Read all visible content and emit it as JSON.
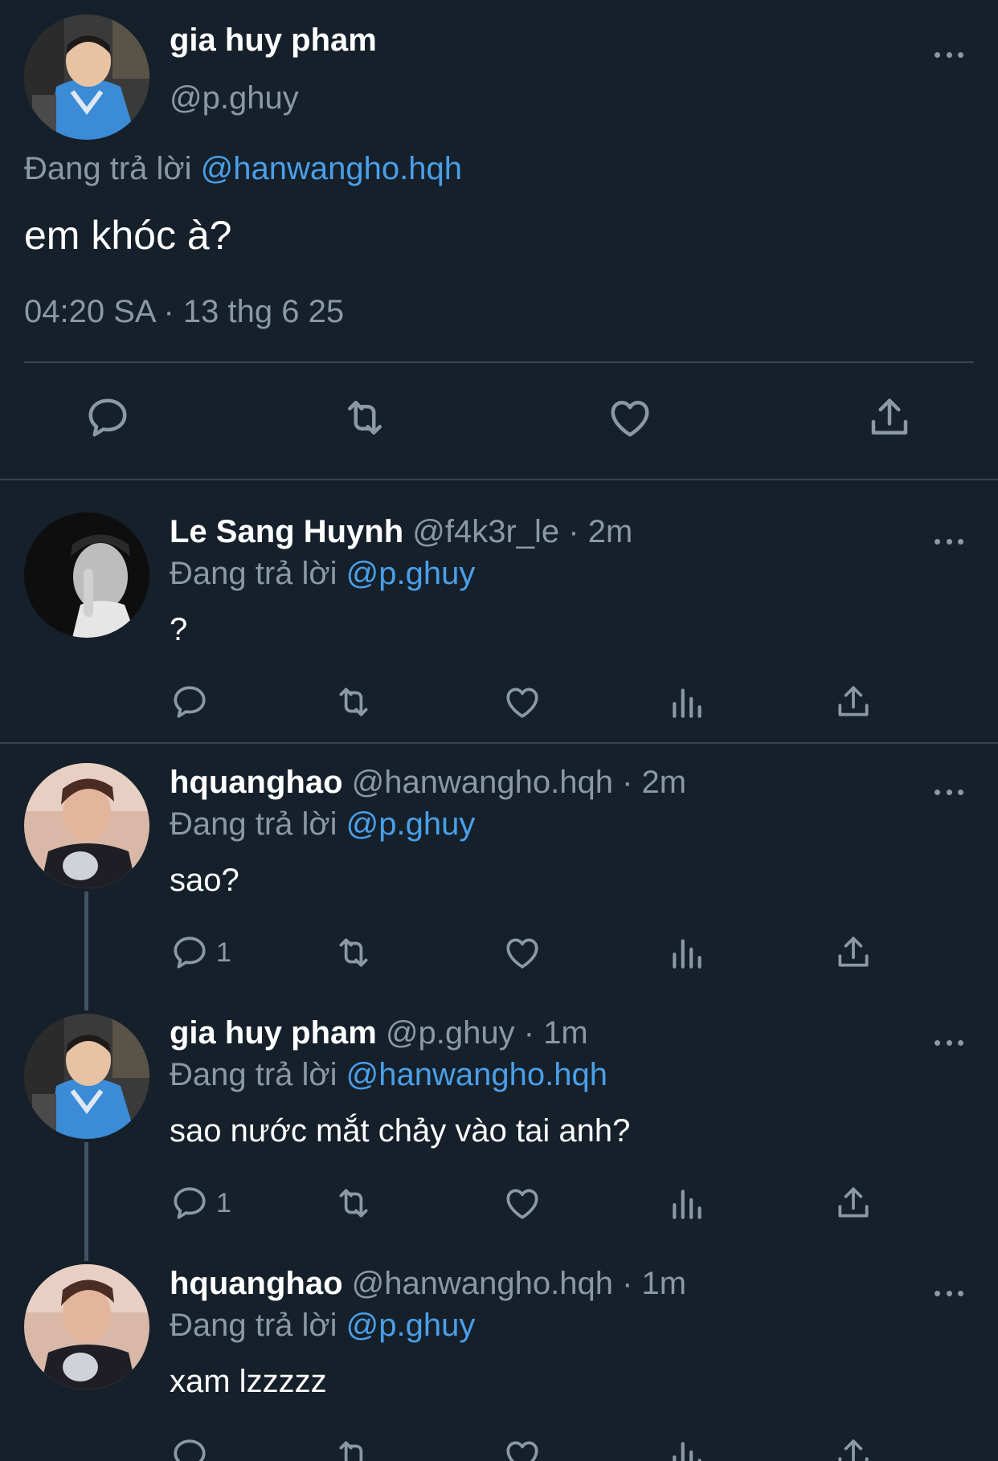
{
  "colors": {
    "background": "#15202b",
    "secondary_text": "#8b98a5",
    "link": "#4a9fe8",
    "divider": "#38444d"
  },
  "main_tweet": {
    "author_name": "gia huy pham",
    "author_handle": "@p.ghuy",
    "replying_prefix": "Đang trả lời",
    "replying_to": "@hanwangho.hqh",
    "text": "em khóc à?",
    "timestamp": "04:20 SA · 13 thg 6 25",
    "actions": [
      "reply-icon",
      "retweet-icon",
      "like-icon",
      "share-icon"
    ]
  },
  "replies": [
    {
      "name": "Le Sang Huynh",
      "meta": "@f4k3r_le · 2m",
      "replying_prefix": "Đang trả lời",
      "replying_to": "@p.ghuy",
      "text": "?",
      "reply_count": ""
    },
    {
      "name": "hquanghao",
      "meta": "@hanwangho.hqh · 2m",
      "replying_prefix": "Đang trả lời",
      "replying_to": "@p.ghuy",
      "text": "sao?",
      "reply_count": "1"
    },
    {
      "name": "gia huy pham",
      "meta": "@p.ghuy · 1m",
      "replying_prefix": "Đang trả lời",
      "replying_to": "@hanwangho.hqh",
      "text": "sao nước mắt chảy vào tai anh?",
      "reply_count": "1"
    },
    {
      "name": "hquanghao",
      "meta": "@hanwangho.hqh · 1m",
      "replying_prefix": "Đang trả lời",
      "replying_to": "@p.ghuy",
      "text": "xam lzzzzz",
      "reply_count": ""
    }
  ]
}
